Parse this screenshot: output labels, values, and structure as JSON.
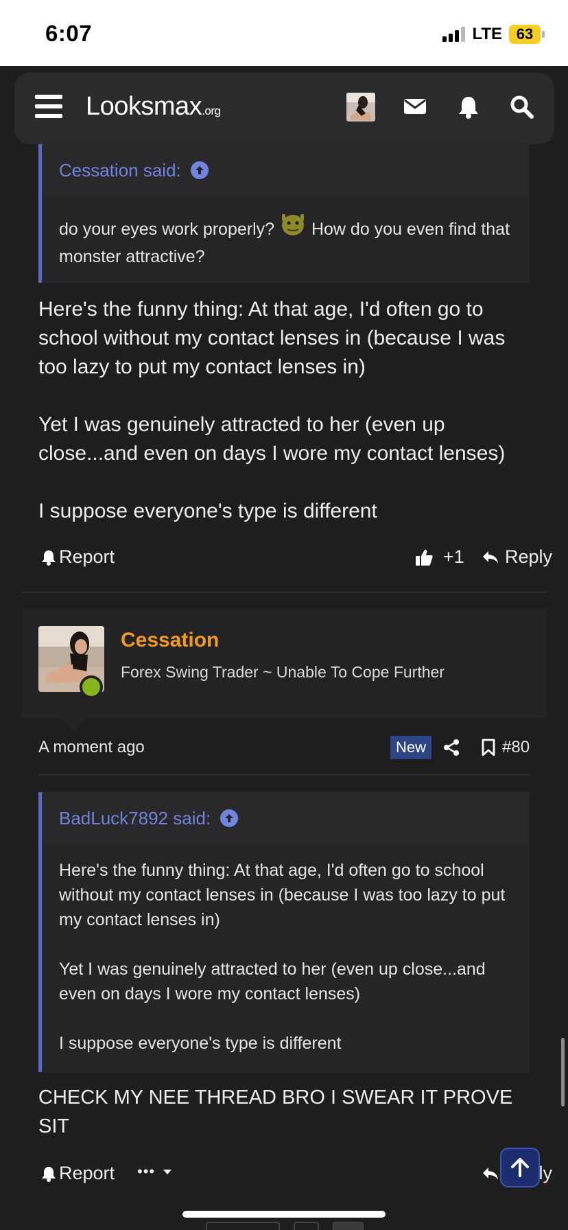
{
  "status_bar": {
    "time": "6:07",
    "network": "LTE",
    "battery": "63"
  },
  "header": {
    "logo_main": "Looksmax",
    "logo_tld": ".org",
    "icons": [
      "menu-icon",
      "avatar",
      "mail-icon",
      "bell-icon",
      "search-icon"
    ]
  },
  "post_79": {
    "quote": {
      "author_said": "Cessation said:",
      "text_before_emoji": "do your eyes work properly?",
      "emoji": "shrek-emoji",
      "text_after_emoji": " How do you even find that monster attractive?"
    },
    "paragraphs": [
      "Here's the funny thing: At that age, I'd often go to school without my contact lenses in (because I was too lazy to put my contact lenses in)",
      "Yet I was genuinely attracted to her (even up close...and even on days I wore my contact lenses)",
      "I suppose everyone's type is different"
    ],
    "report_label": "Report",
    "reaction_count": "+1",
    "reply_label": "Reply"
  },
  "post_80": {
    "user": {
      "name": "Cessation",
      "title": "Forex Swing Trader ~ Unable To Cope Further",
      "online": true
    },
    "timestamp": "A moment ago",
    "badge": "New",
    "post_number": "#80",
    "quote": {
      "author_said": "BadLuck7892 said:",
      "paragraphs": [
        "Here's the funny thing: At that age, I'd often go to school without my contact lenses in (because I was too lazy to put my contact lenses in)",
        "Yet I was genuinely attracted to her (even up close...and even on days I wore my contact lenses)",
        "I suppose everyone's type is different"
      ]
    },
    "text": "CHECK MY NEE THREAD BRO I SWEAR IT PROVE SIT",
    "report_label": "Report",
    "more_label": "•••",
    "reply_label": "Reply"
  },
  "colors": {
    "background": "#1e1e1f",
    "quote_accent": "#5868c9",
    "username": "#f39a1d",
    "online": "#86b61c",
    "new_badge": "#2e4585"
  }
}
